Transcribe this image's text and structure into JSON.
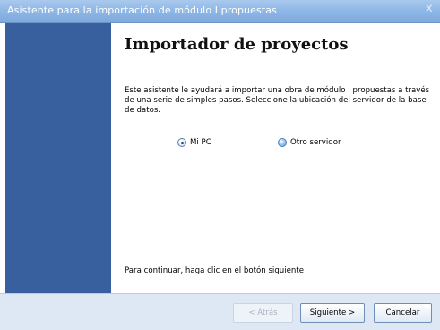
{
  "window": {
    "title": "Asistente para la importación de módulo I propuestas",
    "close_glyph": "x"
  },
  "content": {
    "heading": "Importador de proyectos",
    "description": "Este asistente le ayudará a importar una obra de módulo I propuestas a través de una serie de simples pasos. Seleccione la ubicación del servidor de la base de datos.",
    "location_options": [
      {
        "label": "Mi PC",
        "selected": true
      },
      {
        "label": "Otro servidor",
        "selected": false
      }
    ],
    "footer_instruction": "Para continuar, haga clic en el botón siguiente"
  },
  "buttons": {
    "back_label": "< Atrás",
    "back_enabled": false,
    "next_label": "Siguiente >",
    "cancel_label": "Cancelar"
  },
  "colors": {
    "sidebar": "#39609e",
    "titlebar": "#8db7e6",
    "bottombar": "#dde8f4"
  }
}
